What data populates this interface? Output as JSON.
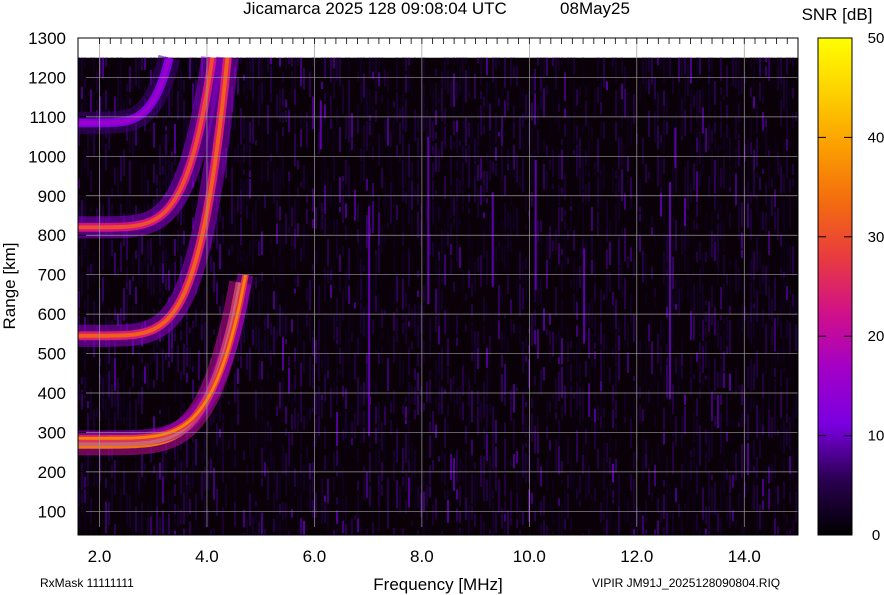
{
  "chart_data": {
    "type": "heatmap",
    "title": "Jicamarca 2025 128 09:08:04 UTC",
    "date_label": "08May25",
    "xlabel": "Frequency [MHz]",
    "ylabel": "Range [km]",
    "xlim": [
      1.6,
      15.0
    ],
    "ylim": [
      40,
      1300
    ],
    "x_ticks": [
      {
        "value": 2.0,
        "label": "2.0"
      },
      {
        "value": 4.0,
        "label": "4.0"
      },
      {
        "value": 6.0,
        "label": "6.0"
      },
      {
        "value": 8.0,
        "label": "8.0"
      },
      {
        "value": 10.0,
        "label": "10.0"
      },
      {
        "value": 12.0,
        "label": "12.0"
      },
      {
        "value": 14.0,
        "label": "14.0"
      }
    ],
    "y_ticks": [
      {
        "value": 100,
        "label": "100"
      },
      {
        "value": 200,
        "label": "200"
      },
      {
        "value": 300,
        "label": "300"
      },
      {
        "value": 400,
        "label": "400"
      },
      {
        "value": 500,
        "label": "500"
      },
      {
        "value": 600,
        "label": "600"
      },
      {
        "value": 700,
        "label": "700"
      },
      {
        "value": 800,
        "label": "800"
      },
      {
        "value": 900,
        "label": "900"
      },
      {
        "value": 1000,
        "label": "1000"
      },
      {
        "value": 1100,
        "label": "1100"
      },
      {
        "value": 1200,
        "label": "1200"
      },
      {
        "value": 1300,
        "label": "1300"
      }
    ],
    "grid": true,
    "colorbar": {
      "label": "SNR [dB]",
      "range": [
        0,
        50
      ],
      "ticks": [
        {
          "value": 0,
          "label": "0"
        },
        {
          "value": 10,
          "label": "10"
        },
        {
          "value": 20,
          "label": "20"
        },
        {
          "value": 30,
          "label": "30"
        },
        {
          "value": 40,
          "label": "40"
        },
        {
          "value": 50,
          "label": "50"
        }
      ],
      "colors": [
        "#000000",
        "#2a0050",
        "#7a00e0",
        "#a200c8",
        "#d0108a",
        "#e83a40",
        "#f36a10",
        "#fb9d00",
        "#fdd000",
        "#ffff00"
      ]
    },
    "traces": [
      {
        "start_range": 270,
        "end_freq": 4.62,
        "end_range": 680,
        "peak_snr": 46,
        "width_km": 14
      },
      {
        "start_range": 285,
        "end_freq": 4.72,
        "end_range": 700,
        "peak_snr": 36,
        "width_km": 10
      },
      {
        "start_range": 545,
        "end_freq": 4.38,
        "end_range": 1250,
        "peak_snr": 32,
        "width_km": 14
      },
      {
        "start_range": 820,
        "end_freq": 4.1,
        "end_range": 1250,
        "peak_snr": 30,
        "width_km": 14
      },
      {
        "start_range": 1085,
        "end_freq": 3.3,
        "end_range": 1250,
        "peak_snr": 16,
        "width_km": 14
      }
    ],
    "max_range_data": 1250
  },
  "footer": {
    "left": "RxMask 11111111",
    "right": "VIPIR  JM91J_2025128090804.RIQ"
  }
}
